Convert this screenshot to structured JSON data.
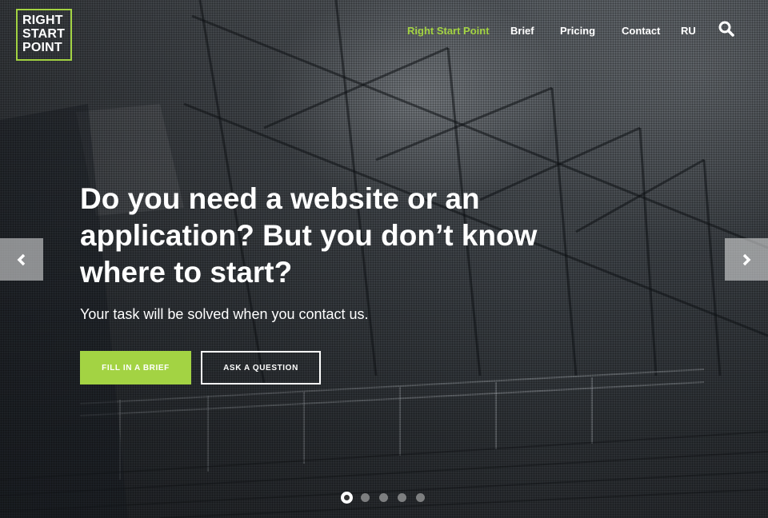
{
  "brand": {
    "logo_lines": [
      "RIGHT",
      "START",
      "POINT"
    ],
    "accent_color": "#a3d343"
  },
  "nav": {
    "items": [
      {
        "label": "Right Start Point",
        "active": true
      },
      {
        "label": "Brief",
        "active": false
      },
      {
        "label": "Pricing",
        "active": false
      },
      {
        "label": "Contact",
        "active": false
      },
      {
        "label": "RU",
        "active": false
      }
    ],
    "search_icon": "search-icon"
  },
  "hero": {
    "headline": "Do you need a website or an application? But you don’t know where to start?",
    "subline": "Your task will be solved when you contact us.",
    "primary_button": "FILL IN A BRIEF",
    "secondary_button": "ASK A QUESTION"
  },
  "slider": {
    "prev_icon": "chevron-left-icon",
    "next_icon": "chevron-right-icon",
    "slide_count": 5,
    "active_slide": 1
  }
}
